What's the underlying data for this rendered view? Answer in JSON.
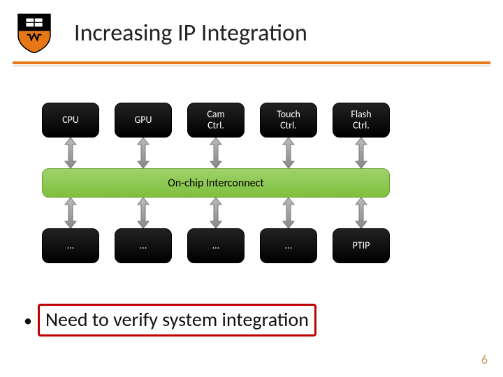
{
  "header": {
    "title": "Increasing IP Integration"
  },
  "colors": {
    "accent_orange": "#e77817",
    "highlight_red": "#c00000",
    "interconnect_green": "#8cc954",
    "block_dark": "#000000"
  },
  "diagram": {
    "top_row": [
      {
        "label": "CPU"
      },
      {
        "label": "GPU"
      },
      {
        "label": "Cam\nCtrl."
      },
      {
        "label": "Touch\nCtrl."
      },
      {
        "label": "Flash\nCtrl."
      }
    ],
    "interconnect_label": "On-chip Interconnect",
    "bottom_row": [
      {
        "label": "…"
      },
      {
        "label": "…"
      },
      {
        "label": "…"
      },
      {
        "label": "…"
      },
      {
        "label": "PTIP"
      }
    ]
  },
  "bullet": {
    "text": "Need to verify system integration"
  },
  "page_number": "6"
}
